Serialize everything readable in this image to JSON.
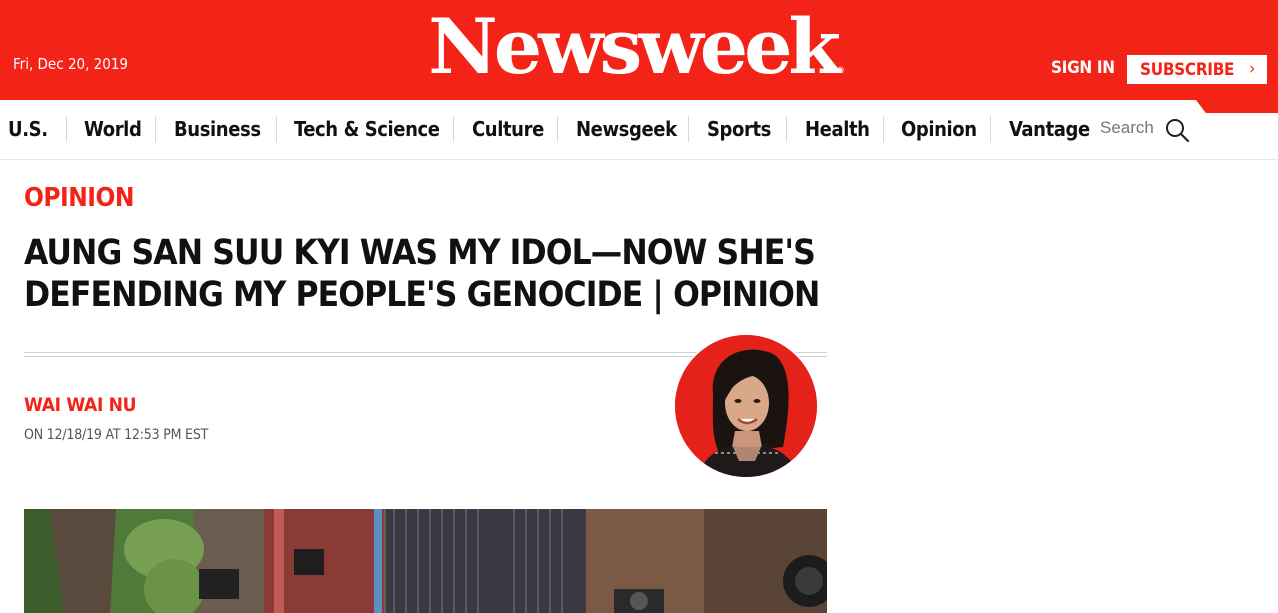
{
  "header": {
    "date": "Fri, Dec 20, 2019",
    "logo": "Newsweek",
    "logo_mark": "®",
    "sign_in": "SIGN IN",
    "subscribe": "SUBSCRIBE",
    "subscribe_chevron": "›",
    "brand_color": "#f42317"
  },
  "nav": {
    "items": [
      "U.S.",
      "World",
      "Business",
      "Tech & Science",
      "Culture",
      "Newsgeek",
      "Sports",
      "Health",
      "Opinion",
      "Vantage"
    ],
    "search_label": "Search",
    "search_icon": "search-icon"
  },
  "article": {
    "section": "OPINION",
    "headline_line1": "AUNG SAN SUU KYI WAS MY IDOL—NOW SHE'S",
    "headline_line2": "DEFENDING MY PEOPLE'S GENOCIDE | OPINION",
    "author": "WAI WAI NU",
    "timestamp": "ON 12/18/19 AT 12:53 PM EST",
    "author_photo": "author-avatar",
    "hero_image": "hero-photo"
  }
}
